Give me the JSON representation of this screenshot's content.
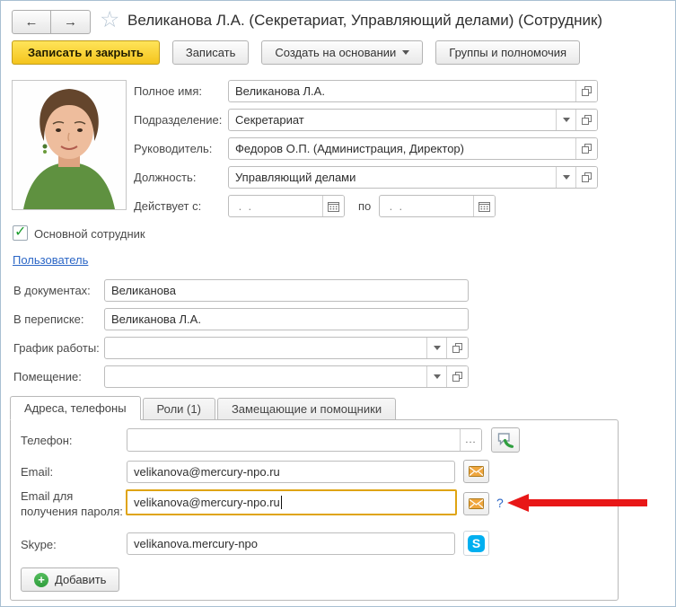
{
  "window": {
    "title": "Великанова Л.А. (Секретариат, Управляющий делами) (Сотрудник)"
  },
  "icons": {
    "back": "←",
    "forward": "→",
    "star": "☆",
    "ellipsis": "...",
    "check": "✓",
    "plus": "+",
    "skype_s": "S"
  },
  "toolbar": {
    "save_close": "Записать и закрыть",
    "save": "Записать",
    "create_based_on": "Создать на основании",
    "groups_permissions": "Группы и полномочия"
  },
  "form": {
    "full_name": {
      "label": "Полное имя:",
      "value": "Великанова Л.А."
    },
    "department": {
      "label": "Подразделение:",
      "value": "Секретариат"
    },
    "manager": {
      "label": "Руководитель:",
      "value": "Федоров О.П. (Администрация, Директор)"
    },
    "position": {
      "label": "Должность:",
      "value": "Управляющий делами"
    },
    "validity": {
      "label": "Действует с:",
      "from_value": " .  .",
      "to_label": "по",
      "to_value": " .  ."
    },
    "main_employee": {
      "label": "Основной сотрудник",
      "checked": true
    },
    "user_link": "Пользователь",
    "in_documents": {
      "label": "В документах:",
      "value": "Великанова"
    },
    "in_correspondence": {
      "label": "В переписке:",
      "value": "Великанова Л.А."
    },
    "work_schedule": {
      "label": "График работы:",
      "value": ""
    },
    "room": {
      "label": "Помещение:",
      "value": ""
    }
  },
  "tabs": [
    {
      "label": "Адреса, телефоны",
      "active": true
    },
    {
      "label": "Роли (1)",
      "active": false
    },
    {
      "label": "Замещающие и помощники",
      "active": false
    }
  ],
  "contacts": {
    "phone": {
      "label": "Телефон:",
      "value": ""
    },
    "email": {
      "label": "Email:",
      "value": "velikanova@mercury-npo.ru"
    },
    "password_email": {
      "label": "Email для получения пароля:",
      "value": "velikanova@mercury-npo.ru",
      "help": "?"
    },
    "skype": {
      "label": "Skype:",
      "value": "velikanova.mercury-npo"
    },
    "add_button": "Добавить"
  },
  "colors": {
    "accent_yellow": "#f4c41d",
    "focus_border": "#dfa412",
    "link_blue": "#2b66c6",
    "arrow_red": "#e81717",
    "skype_blue": "#00aff0",
    "envelope_orange": "#efa63e",
    "check_green": "#1d9e2f",
    "plus_green": "#2f9e3c"
  }
}
